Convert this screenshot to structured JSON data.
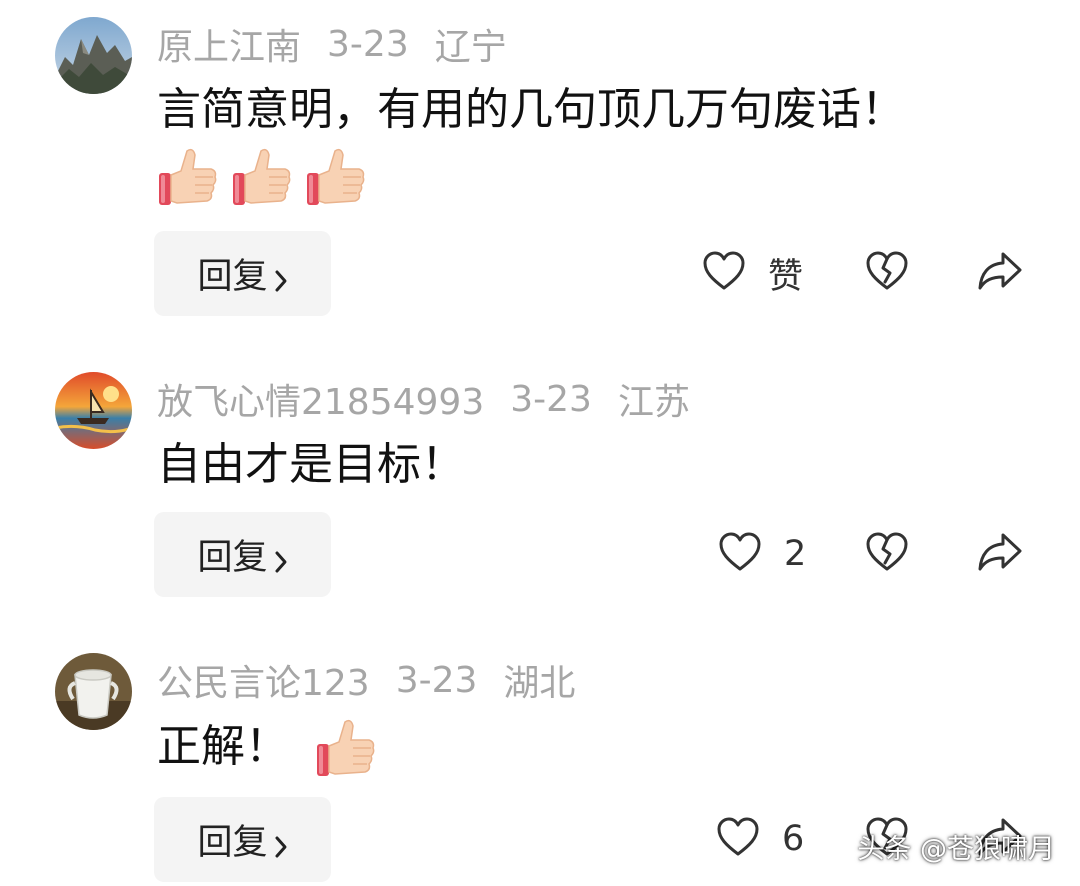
{
  "comments": [
    {
      "username": "原上江南",
      "date": "3-23",
      "location": "辽宁",
      "text": "言简意明，有用的几句顶几万句废话！",
      "emoji_count": 3,
      "avatar_icon": "mountain-photo",
      "reply_label": "回复",
      "like_label": "赞"
    },
    {
      "username": "放飞心情21854993",
      "date": "3-23",
      "location": "江苏",
      "text": "自由才是目标！",
      "emoji_count": 0,
      "avatar_icon": "sunset-boat-painting",
      "reply_label": "回复",
      "like_label": "2"
    },
    {
      "username": "公民言论123",
      "date": "3-23",
      "location": "湖北",
      "text": "正解！",
      "emoji_count": 1,
      "avatar_icon": "white-cup-photo",
      "reply_label": "回复",
      "like_label": "6"
    }
  ],
  "watermark": "头条 @苍狼啸月",
  "colors": {
    "meta_text": "#a6a6a6",
    "body_text": "#111111",
    "reply_bg": "#f4f4f4",
    "icon_stroke": "#333333"
  },
  "icons": [
    "like-heart-icon",
    "dislike-broken-heart-icon",
    "share-arrow-icon",
    "thumbs-up-emoji",
    "chevron-right-icon"
  ]
}
